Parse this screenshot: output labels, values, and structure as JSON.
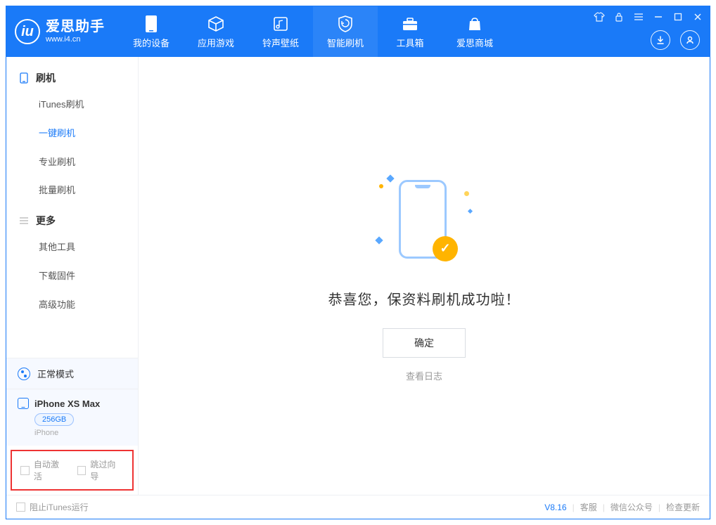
{
  "app": {
    "name": "爱思助手",
    "url": "www.i4.cn"
  },
  "nav": {
    "items": [
      {
        "label": "我的设备"
      },
      {
        "label": "应用游戏"
      },
      {
        "label": "铃声壁纸"
      },
      {
        "label": "智能刷机"
      },
      {
        "label": "工具箱"
      },
      {
        "label": "爱思商城"
      }
    ]
  },
  "sidebar": {
    "group1": {
      "title": "刷机",
      "items": [
        "iTunes刷机",
        "一键刷机",
        "专业刷机",
        "批量刷机"
      ],
      "activeIndex": 1
    },
    "group2": {
      "title": "更多",
      "items": [
        "其他工具",
        "下载固件",
        "高级功能"
      ]
    },
    "mode": "正常模式",
    "device": {
      "name": "iPhone XS Max",
      "storage": "256GB",
      "type": "iPhone"
    },
    "options": {
      "opt1": "自动激活",
      "opt2": "跳过向导"
    }
  },
  "main": {
    "message": "恭喜您，保资料刷机成功啦！",
    "ok": "确定",
    "logLink": "查看日志"
  },
  "footer": {
    "stopItunes": "阻止iTunes运行",
    "version": "V8.16",
    "links": [
      "客服",
      "微信公众号",
      "检查更新"
    ]
  }
}
